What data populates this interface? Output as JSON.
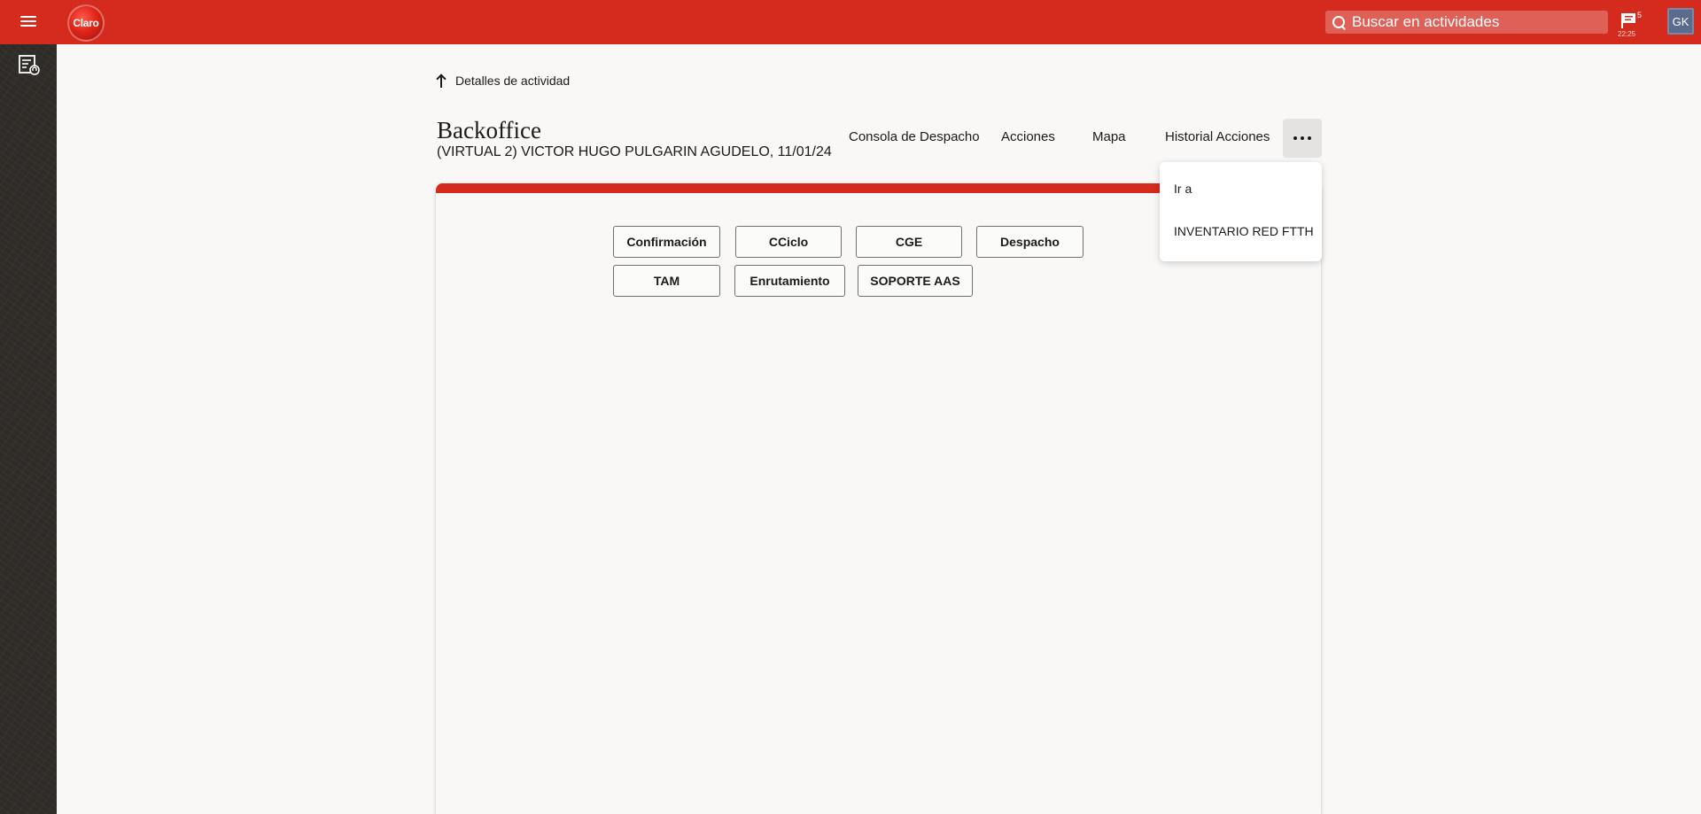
{
  "topbar": {
    "logo_text": "Claro",
    "search": {
      "placeholder": "Buscar en actividades",
      "value": ""
    },
    "notifications": {
      "count": "5",
      "time": "22:25"
    },
    "user": {
      "initials": "GK"
    },
    "colors": {
      "brand": "#d52b1e"
    }
  },
  "sidebar": {
    "items": [
      {
        "icon": "activity-list-icon"
      }
    ]
  },
  "header": {
    "back_label": "Detalles de actividad",
    "title": "Backoffice",
    "subtitle": "(VIRTUAL 2) VICTOR HUGO PULGARIN AGUDELO, 11/01/24",
    "tabs": [
      {
        "label": "Consola de Despacho"
      },
      {
        "label": "Acciones"
      },
      {
        "label": "Mapa"
      },
      {
        "label": "Historial Acciones"
      }
    ]
  },
  "panel": {
    "buttons": [
      {
        "label": "Confirmación"
      },
      {
        "label": "CCiclo"
      },
      {
        "label": "CGE"
      },
      {
        "label": "Despacho"
      },
      {
        "label": "TAM"
      },
      {
        "label": "Enrutamiento"
      },
      {
        "label": "SOPORTE AAS"
      }
    ]
  },
  "dropdown": {
    "items": [
      {
        "label": "Ir a"
      },
      {
        "label": "INVENTARIO RED FTTH"
      }
    ]
  }
}
